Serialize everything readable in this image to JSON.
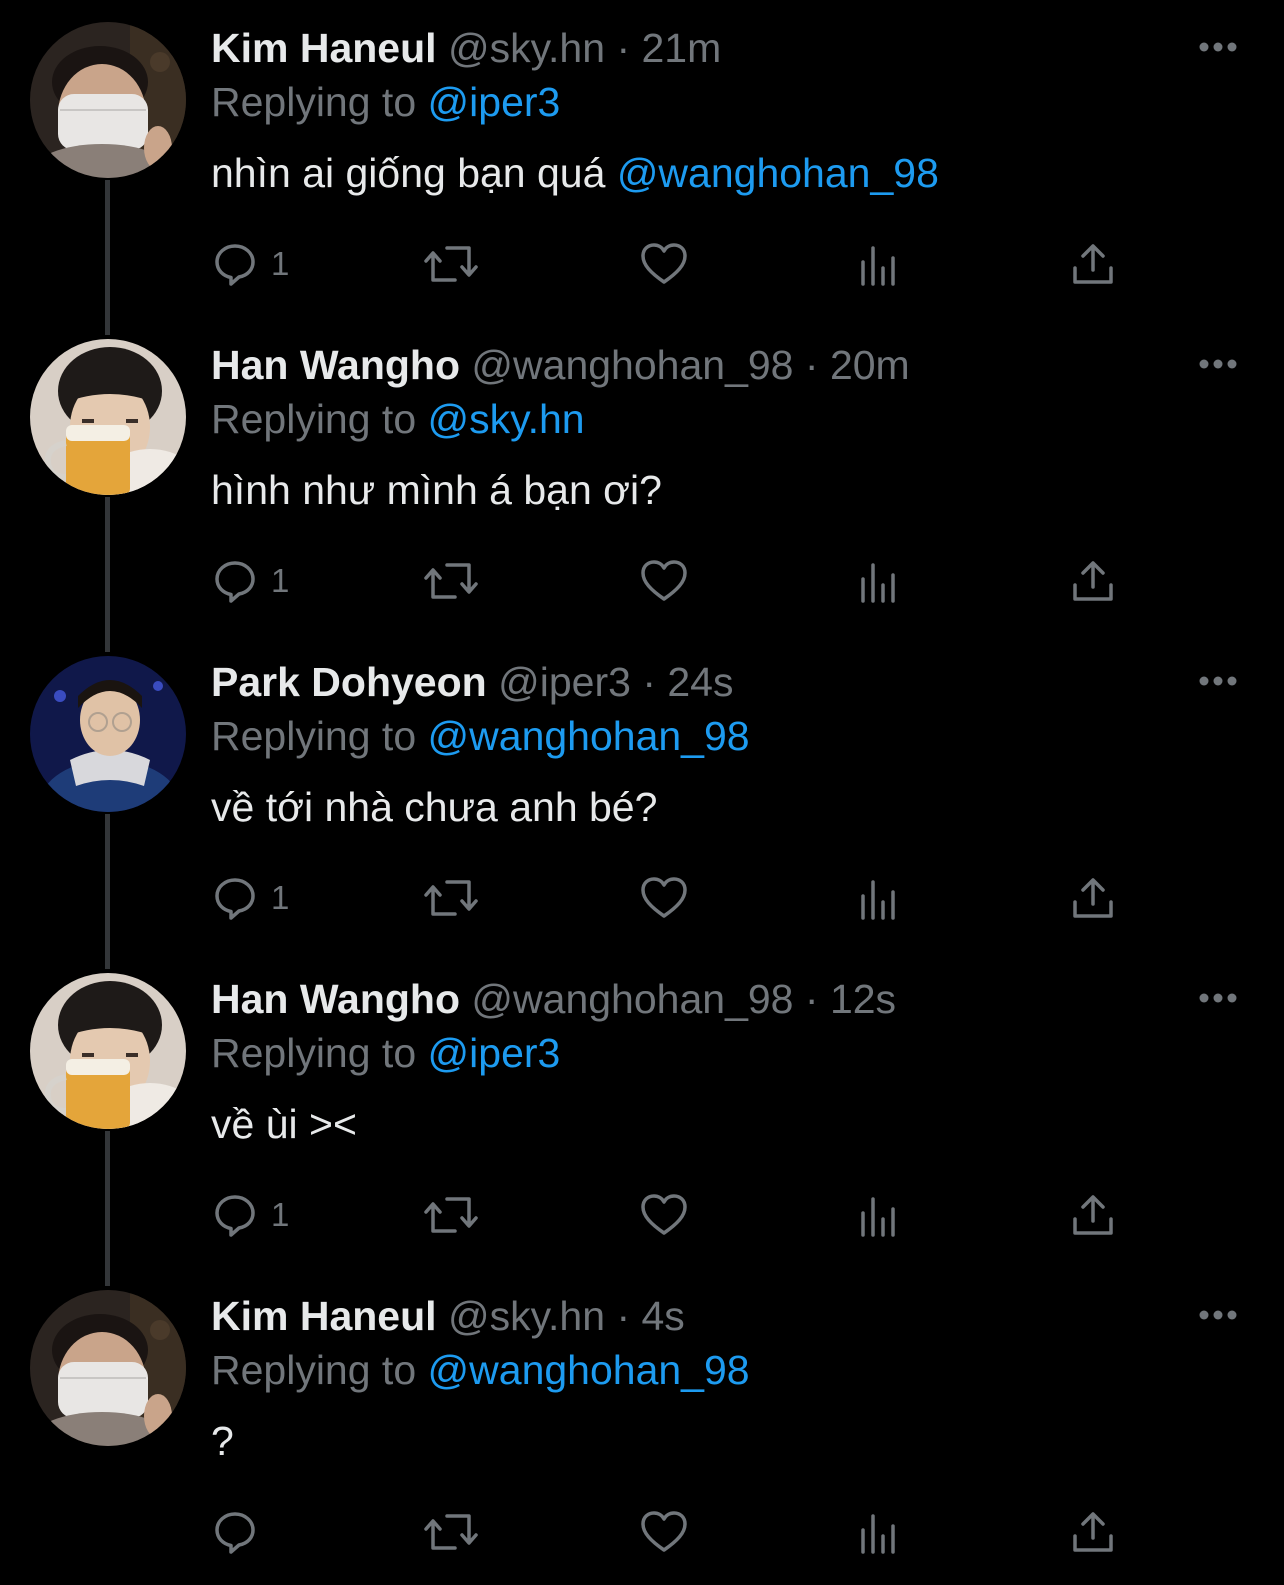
{
  "tweets": [
    {
      "name": "Kim Haneul",
      "handle": "@sky.hn",
      "time": "21m",
      "replying_prefix": "Replying to",
      "replying_to": "@iper3",
      "text": "nhìn ai giống bạn quá",
      "text_mention": "@wanghohan_98",
      "reply_count": "1",
      "avatar": "masked-person-avatar"
    },
    {
      "name": "Han Wangho",
      "handle": "@wanghohan_98",
      "time": "20m",
      "replying_prefix": "Replying to",
      "replying_to": "@sky.hn",
      "text": "hình như mình á bạn ơi?",
      "text_mention": "",
      "reply_count": "1",
      "avatar": "beer-person-avatar"
    },
    {
      "name": "Park Dohyeon",
      "handle": "@iper3",
      "time": "24s",
      "replying_prefix": "Replying to",
      "replying_to": "@wanghohan_98",
      "text": "về tới nhà chưa anh bé?",
      "text_mention": "",
      "reply_count": "1",
      "avatar": "glasses-person-avatar"
    },
    {
      "name": "Han Wangho",
      "handle": "@wanghohan_98",
      "time": "12s",
      "replying_prefix": "Replying to",
      "replying_to": "@iper3",
      "text": "về ùi ><",
      "text_mention": "",
      "reply_count": "1",
      "avatar": "beer-person-avatar"
    },
    {
      "name": "Kim Haneul",
      "handle": "@sky.hn",
      "time": "4s",
      "replying_prefix": "Replying to",
      "replying_to": "@wanghohan_98",
      "text": "?",
      "text_mention": "",
      "reply_count": "",
      "avatar": "masked-person-avatar"
    }
  ],
  "separator": "·",
  "icons": {
    "reply": "reply-icon",
    "retweet": "retweet-icon",
    "like": "heart-icon",
    "views": "views-icon",
    "share": "share-icon",
    "more": "more-icon"
  },
  "colors": {
    "background": "#000000",
    "text_primary": "#e7e9ea",
    "text_secondary": "#71767b",
    "accent": "#1d9bf0",
    "thread_line": "#333639"
  }
}
